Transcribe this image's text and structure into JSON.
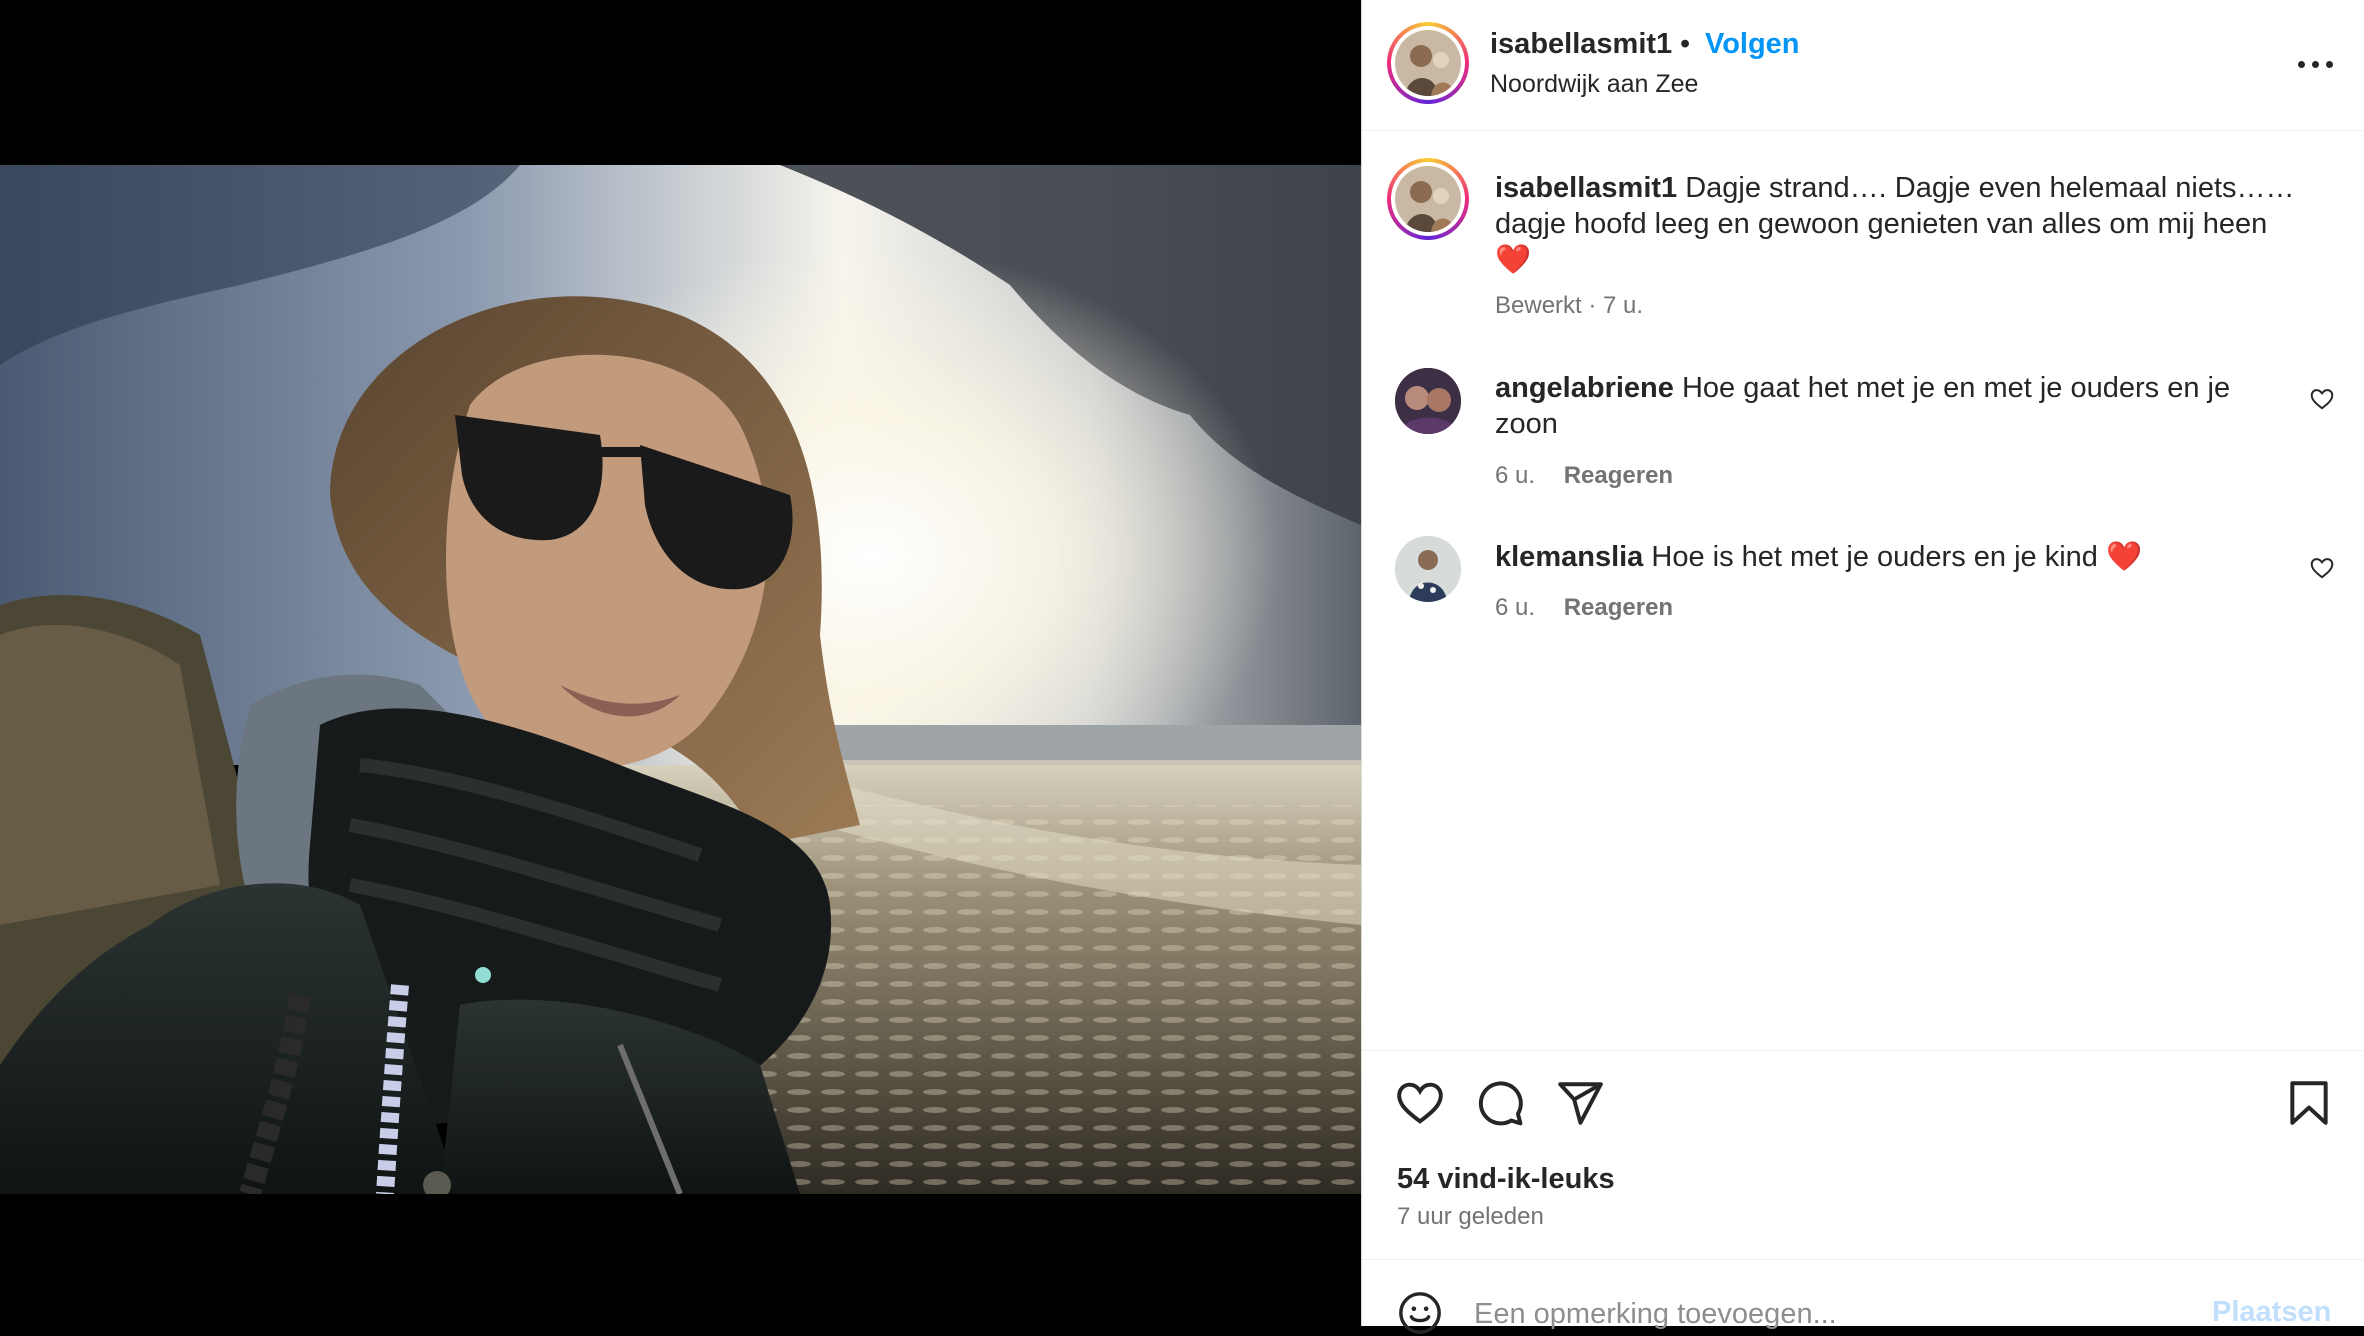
{
  "post": {
    "author": "isabellasmit1",
    "separator": "•",
    "follow_label": "Volgen",
    "location": "Noordwijk aan Zee",
    "more_icon": "more-horizontal-icon"
  },
  "caption": {
    "username": "isabellasmit1",
    "text": "Dagje strand…. Dagje even helemaal niets…… dagje hoofd leeg en gewoon genieten van alles om mij heen ❤️",
    "meta": "Bewerkt · 7 u."
  },
  "comments": [
    {
      "username": "angelabriene",
      "text": "Hoe gaat het met je en met je ouders en je zoon",
      "time": "6 u.",
      "reply_label": "Reageren"
    },
    {
      "username": "klemanslia",
      "text": "Hoe is het met je ouders en je kind ❤️",
      "time": "6 u.",
      "reply_label": "Reageren"
    }
  ],
  "stats": {
    "likes": "54 vind-ik-leuks",
    "posted": "7 uur geleden"
  },
  "composer": {
    "placeholder": "Een opmerking toevoegen...",
    "post_label": "Plaatsen"
  },
  "colors": {
    "link_blue": "#0095f6",
    "text": "#262626",
    "secondary_text": "#737373",
    "post_disabled": "#c0dffd"
  }
}
